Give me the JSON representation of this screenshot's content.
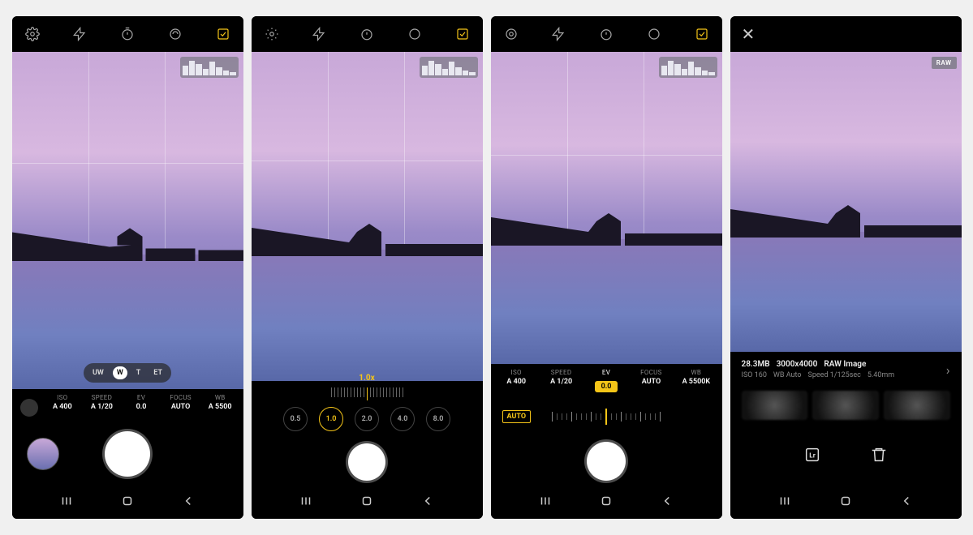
{
  "topIcons": [
    "settings",
    "flash",
    "timer",
    "ratio",
    "grid"
  ],
  "zoomPill": [
    "UW",
    "W",
    "T",
    "ET"
  ],
  "zoomPillSelected": "W",
  "params1": [
    {
      "label": "ISO",
      "value": "A 400"
    },
    {
      "label": "SPEED",
      "value": "A 1/20"
    },
    {
      "label": "EV",
      "value": "0.0"
    },
    {
      "label": "FOCUS",
      "value": "AUTO"
    },
    {
      "label": "WB",
      "value": "A 5500"
    }
  ],
  "zoomMarker": "1.0x",
  "zoomValues": [
    "0.5",
    "1.0",
    "2.0",
    "4.0",
    "8.0"
  ],
  "zoomSelected": "1.0",
  "params3": [
    {
      "label": "ISO",
      "value": "A 400"
    },
    {
      "label": "SPEED",
      "value": "A 1/20"
    },
    {
      "label": "EV",
      "value": "0.0",
      "active": true
    },
    {
      "label": "FOCUS",
      "value": "AUTO"
    },
    {
      "label": "WB",
      "value": "A 5500K"
    }
  ],
  "evAuto": "AUTO",
  "review": {
    "size": "28.3MB",
    "dims": "3000x4000",
    "type": "RAW Image",
    "iso": "ISO 160",
    "wb": "WB Auto",
    "speed": "Speed 1/125sec",
    "focal": "5.40mm"
  },
  "rawBadge": "RAW"
}
